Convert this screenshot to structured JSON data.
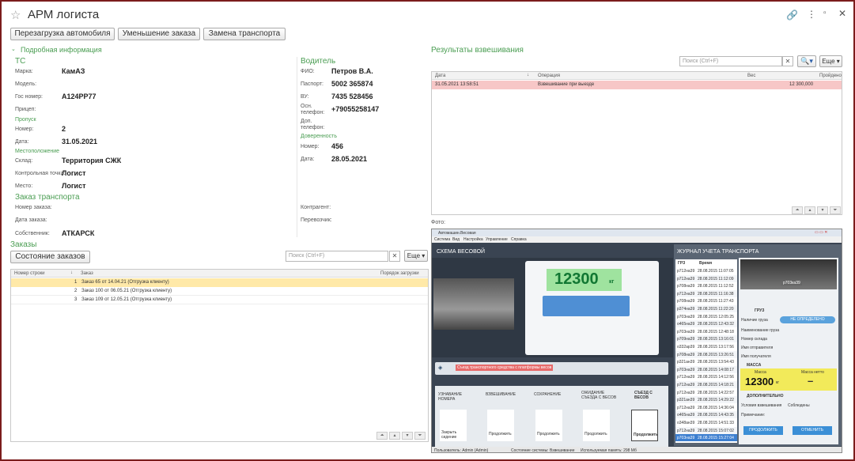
{
  "window": {
    "title": "АРМ логиста"
  },
  "toolbar": {
    "btn1": "Перезагрузка автомобиля",
    "btn2": "Уменьшение заказа",
    "btn3": "Замена транспорта"
  },
  "details": {
    "header": "Подробная информация",
    "ts": {
      "title": "ТС",
      "brand_label": "Марка:",
      "brand": "КамАЗ",
      "model_label": "Модель:",
      "model": "",
      "plate_label": "Гос номер:",
      "plate": "А124РР77",
      "trailer_label": "Прицеп:",
      "trailer": ""
    },
    "pass": {
      "title": "Пропуск",
      "num_label": "Номер:",
      "num": "2",
      "date_label": "Дата:",
      "date": "31.05.2021"
    },
    "location": {
      "title": "Местоположение",
      "wh_label": "Склад:",
      "wh": "Территория СЖК",
      "cp_label": "Контрольная точка:",
      "cp": "Логист",
      "place_label": "Место:",
      "place": "Логист"
    },
    "order": {
      "title": "Заказ транспорта",
      "num_label": "Номер заказа:",
      "date_label": "Дата заказа:",
      "owner_label": "Собственник:",
      "owner": "АТКАРСК",
      "contr_label": "Контрагент:",
      "carrier_label": "Перевозчик:"
    },
    "driver": {
      "title": "Водитель",
      "fio_label": "ФИО:",
      "fio": "Петров В.А.",
      "passport_label": "Паспорт:",
      "passport": "5002 365874",
      "vu_label": "ВУ:",
      "vu": "7435 528456",
      "phone_label": "Осн. телефон:",
      "phone": "+79055258147",
      "phone2_label": "Доп. телефон:"
    },
    "proxy": {
      "title": "Доверенность",
      "num_label": "Номер:",
      "num": "456",
      "date_label": "Дата:",
      "date": "28.05.2021"
    }
  },
  "orders": {
    "title": "Заказы",
    "state_btn": "Состояние заказов",
    "search_placeholder": "Поиск (Ctrl+F)",
    "more": "Еще",
    "cols": [
      "Номер строки",
      "Заказ",
      "Порядок загрузки"
    ],
    "rows": [
      {
        "n": "1",
        "order": "Заказ 65 от 14.04.21 (Отгрузка клиенту)"
      },
      {
        "n": "2",
        "order": "Заказ 100 от 06.05.21 (Отгрузка клиенту)"
      },
      {
        "n": "3",
        "order": "Заказ 109 от 12.05.21 (Отгрузка клиенту)"
      }
    ]
  },
  "weighing": {
    "title": "Результаты взвешивания",
    "search_placeholder": "Поиск (Ctrl+F)",
    "more": "Еще",
    "cols": [
      "Дата",
      "Операция",
      "Вес",
      "Пройдено"
    ],
    "rows": [
      {
        "date": "31.05.2021 13:58:51",
        "op": "Взвешивание при выезде",
        "weight": "12 300,000"
      }
    ]
  },
  "photo": {
    "label": "Фото:",
    "app_title": "Автомашин.Весовая",
    "menu": [
      "Система",
      "Вид",
      "Настройка",
      "Управление",
      "Справка"
    ],
    "scheme_title": "СХЕМА ВЕСОВОЙ",
    "weight": "12300",
    "weight_unit": "кг",
    "alert": "Съезд транспортного средства с платформы весов",
    "steps": [
      "УЗНАВАНИЕ НОМЕРА",
      "ВЗВЕШИВАНИЕ",
      "СОХРАНЕНИЕ",
      "ОЖИДАНИЕ СЪЕЗДА С ВЕСОВ",
      "СЪЕЗД С ВЕСОВ"
    ],
    "step_btns": [
      "Закрыть сидение",
      "Продолжить",
      "Продолжить",
      "Продолжить",
      "Продолжить"
    ],
    "journal_title": "ЖУРНАЛ УЧЕТА ТРАНСПОРТА",
    "journal_cols": [
      "ГРЗ",
      "Время"
    ],
    "journal_rows": [
      [
        "р712на39",
        "28.08.2015 11:07:05"
      ],
      [
        "р712на39",
        "28.08.2015 11:12:09"
      ],
      [
        "р708на39",
        "28.08.2015 11:12:52"
      ],
      [
        "р712на39",
        "28.08.2015 11:16:38"
      ],
      [
        "р708на39",
        "28.08.2015 11:27:43"
      ],
      [
        "р374на39",
        "28.08.2015 11:22:20"
      ],
      [
        "р703на39",
        "28.08.2015 12:05:25"
      ],
      [
        "о465на39",
        "28.08.2015 12:43:32"
      ],
      [
        "р703на39",
        "28.08.2015 12:48:18"
      ],
      [
        "р709на39",
        "28.08.2015 13:16:01"
      ],
      [
        "о332ар39",
        "28.08.2015 13:17:56"
      ],
      [
        "р708на39",
        "28.08.2015 13:26:51"
      ],
      [
        "р321ан39",
        "28.08.2015 13:54:43"
      ],
      [
        "р703на39",
        "28.08.2015 14:08:17"
      ],
      [
        "р712на39",
        "28.08.2015 14:12:56"
      ],
      [
        "р712на39",
        "28.08.2015 14:18:21"
      ],
      [
        "р712на39",
        "28.08.2015 14:22:57"
      ],
      [
        "р321ан39",
        "28.08.2015 14:29:22"
      ],
      [
        "р712на39",
        "28.08.2015 14:36:04"
      ],
      [
        "о465на39",
        "28.08.2015 14:43:35"
      ],
      [
        "о348ан39",
        "28.08.2015 14:51:33"
      ],
      [
        "р712на39",
        "28.08.2015 15:07:02"
      ],
      [
        "р703на39",
        "28.08.2015 15:27:04"
      ]
    ],
    "plate": "р703ка39",
    "cargo_title": "ГРУЗ",
    "cargo_presence": "Наличие груза",
    "not_defined": "НЕ ОПРЕДЕЛЕНО",
    "cargo_fields": [
      "Наименование груза",
      "Номер склада",
      "Имя отправителя",
      "Имя получателя"
    ],
    "mass_title": "МАССА",
    "mass_label": "Масса",
    "net_label": "Масса нетто",
    "mass": "12300",
    "mass_unit": "кг",
    "net": "–",
    "extra_title": "ДОПОЛНИТЕЛЬНО",
    "conditions": "Условия взвешивания",
    "observed": "Соблюдены",
    "note": "Примечание:",
    "btn_ok": "ПРОДОЛЖИТЬ",
    "btn_cancel": "ОТМЕНИТЬ",
    "status_user": "Пользователь: Admin (Admin)",
    "status_state": "Состояние системы: Взвешивание",
    "status_mem": "Используемая память: 298 Мб"
  },
  "colors": {
    "accent": "#4a9d52",
    "selected_row": "#ffe9a8",
    "weigh_row": "#f7c7c7",
    "frame": "#7b1c1c"
  }
}
